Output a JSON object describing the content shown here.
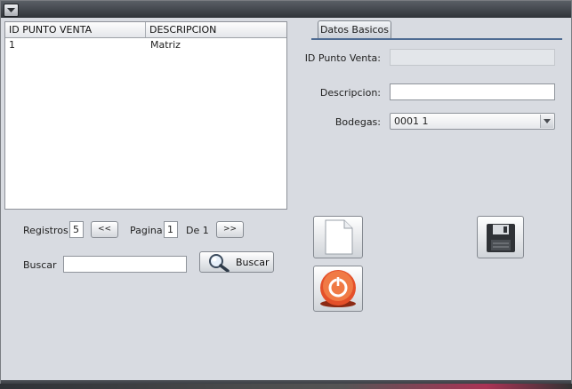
{
  "table": {
    "columns": [
      "ID PUNTO VENTA",
      "DESCRIPCION"
    ],
    "rows": [
      {
        "id": "1",
        "descripcion": "Matriz"
      }
    ]
  },
  "tabs": [
    {
      "label": "Datos Basicos",
      "active": true
    }
  ],
  "form": {
    "id_label": "ID Punto Venta:",
    "id_value": "",
    "descripcion_label": "Descripcion:",
    "descripcion_value": "",
    "bodegas_label": "Bodegas:",
    "bodegas_selected": "0001 1"
  },
  "pager": {
    "registros_label": "Registros",
    "registros_value": "5",
    "prev_label": "<<",
    "pagina_label": "Pagina",
    "pagina_value": "1",
    "de_label": "De 1",
    "next_label": ">>"
  },
  "search": {
    "label": "Buscar",
    "value": "",
    "button_label": "Buscar",
    "icon": "magnifier-icon"
  },
  "actions": {
    "new_icon": "new-document-icon",
    "exit_icon": "power-icon",
    "save_icon": "floppy-disk-icon"
  },
  "colors": {
    "background": "#d8dbe1",
    "titlebar": "#2f3338",
    "tab_underline": "#4e6b92",
    "power_button": "#e4502a"
  }
}
